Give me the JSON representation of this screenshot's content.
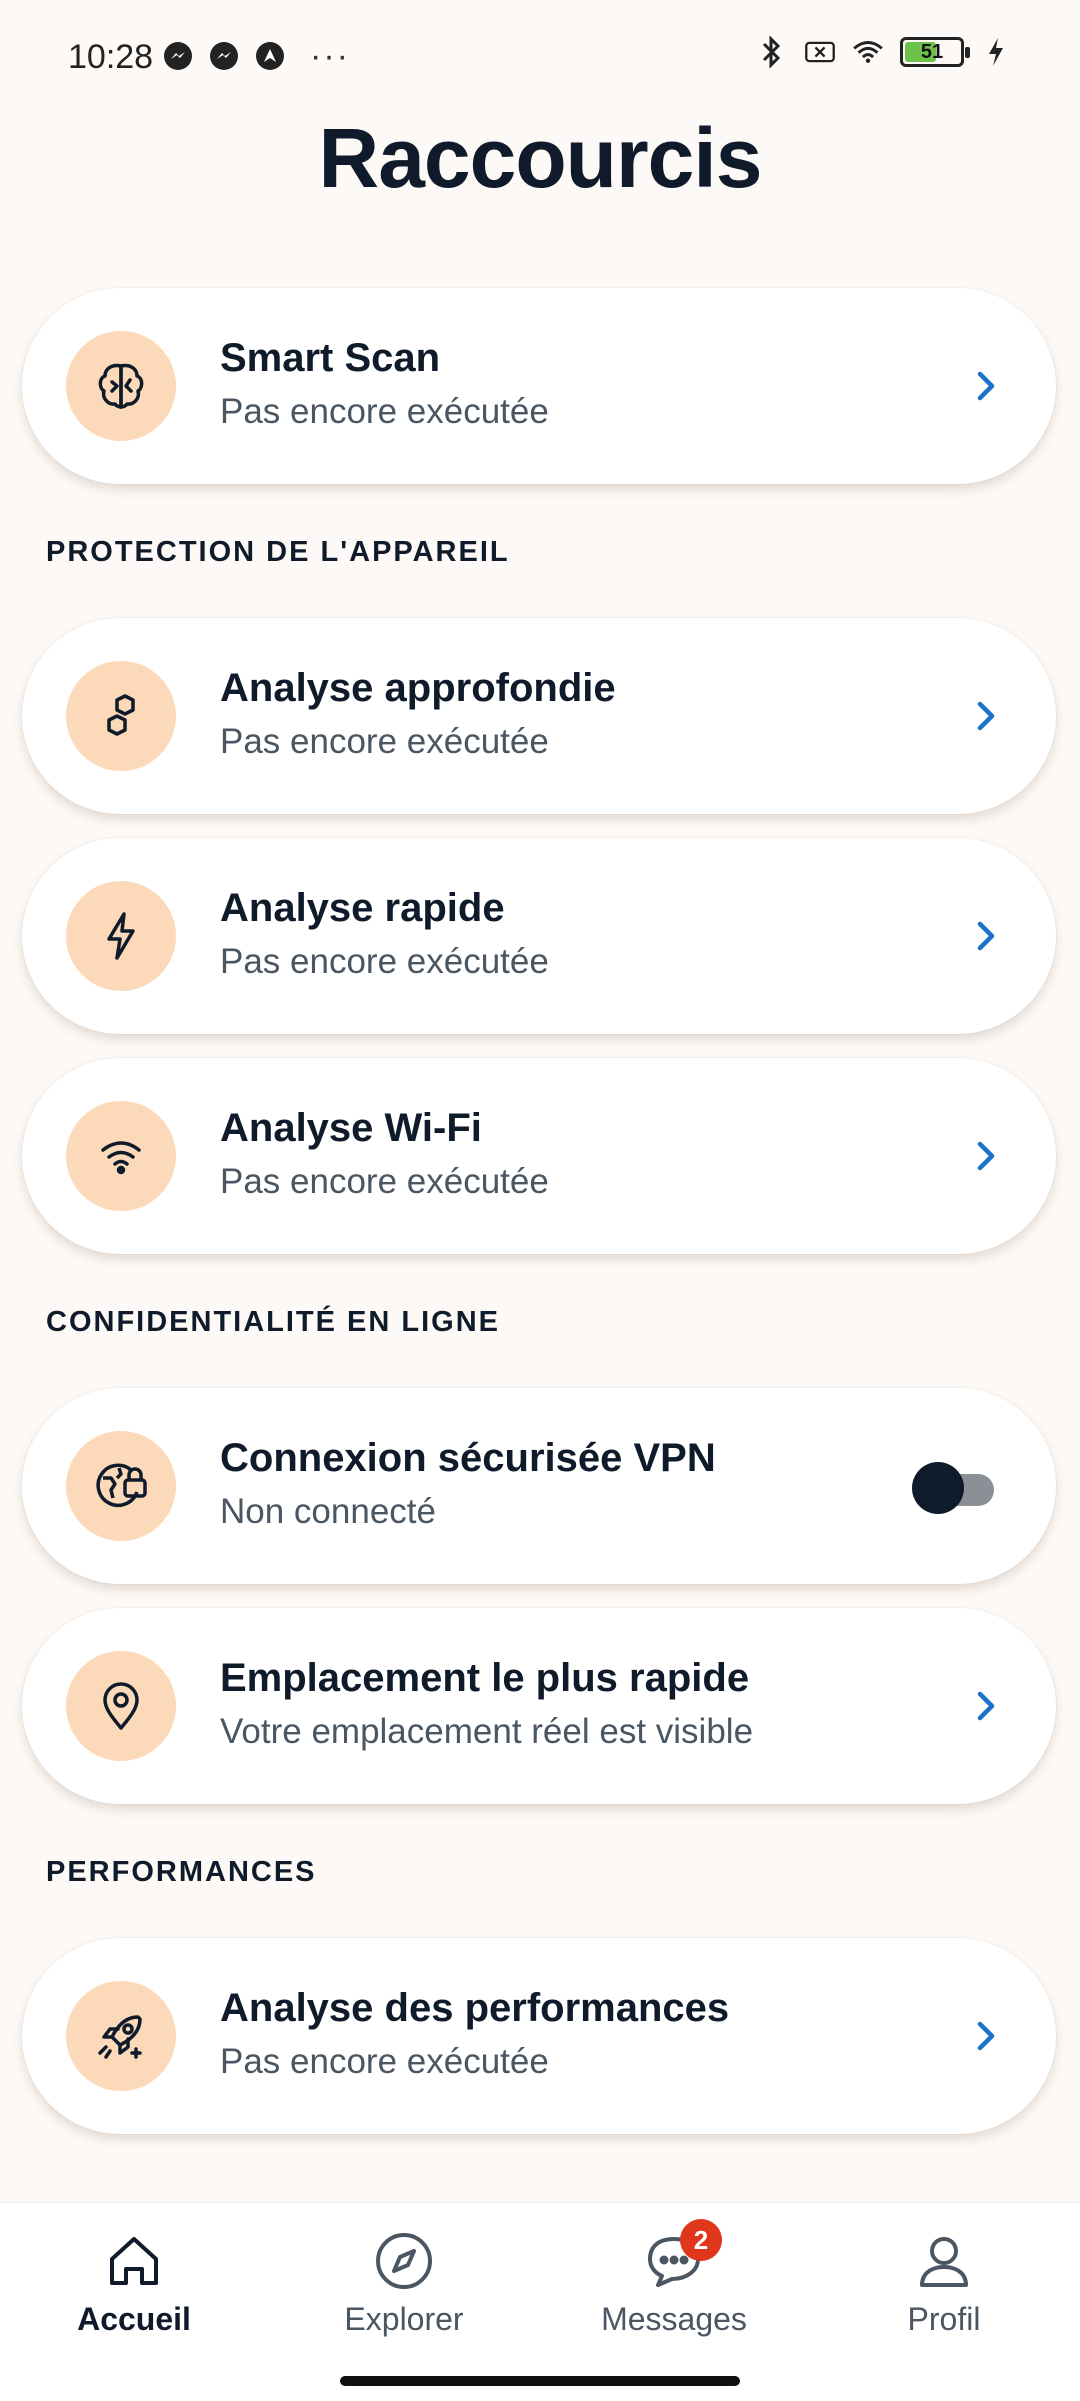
{
  "status_bar": {
    "time": "10:28",
    "battery_level": "51",
    "icons": [
      "messenger-icon",
      "messenger-icon",
      "avast-icon",
      "more-dots-icon",
      "bluetooth-icon",
      "no-sim-icon",
      "wifi-icon",
      "battery-icon",
      "charging-bolt-icon"
    ]
  },
  "page": {
    "title": "Raccourcis"
  },
  "smart_scan": {
    "title": "Smart Scan",
    "subtitle": "Pas encore exécutée",
    "icon": "brain-icon"
  },
  "sections": {
    "device_protection": "PROTECTION DE L'APPAREIL",
    "online_privacy": "CONFIDENTIALITÉ EN LIGNE",
    "performance": "PERFORMANCES"
  },
  "deep_scan": {
    "title": "Analyse approfondie",
    "subtitle": "Pas encore exécutée",
    "icon": "hexagons-icon"
  },
  "quick_scan": {
    "title": "Analyse rapide",
    "subtitle": "Pas encore exécutée",
    "icon": "lightning-icon"
  },
  "wifi_scan": {
    "title": "Analyse Wi-Fi",
    "subtitle": "Pas encore exécutée",
    "icon": "wifi-icon"
  },
  "vpn": {
    "title": "Connexion sécurisée VPN",
    "subtitle": "Non connecté",
    "icon": "globe-lock-icon",
    "enabled": false
  },
  "fastest_location": {
    "title": "Emplacement le plus rapide",
    "subtitle": "Votre emplacement réel est visible",
    "icon": "location-pin-icon"
  },
  "performance_scan": {
    "title": "Analyse des performances",
    "subtitle": "Pas encore exécutée",
    "icon": "rocket-icon"
  },
  "bottom_nav": {
    "home": "Accueil",
    "explore": "Explorer",
    "messages": "Messages",
    "messages_badge": "2",
    "profile": "Profil"
  },
  "colors": {
    "background": "#fdf9f6",
    "icon_circle": "#fcd9b8",
    "chevron": "#1a73c9",
    "badge": "#e0361c",
    "text_primary": "#0f1b2b"
  }
}
